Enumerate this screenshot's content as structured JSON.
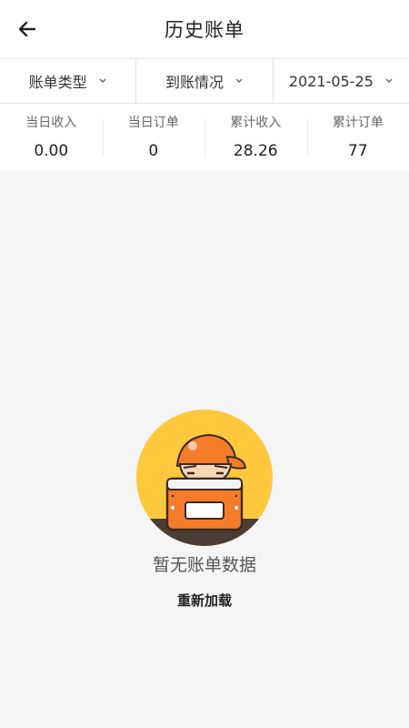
{
  "header": {
    "title": "历史账单",
    "back_icon": "arrow-left-icon"
  },
  "filters": [
    {
      "label": "账单类型",
      "icon": "chevron-down-icon"
    },
    {
      "label": "到账情况",
      "icon": "chevron-down-icon"
    },
    {
      "label": "2021-05-25",
      "icon": "chevron-down-icon"
    }
  ],
  "stats": [
    {
      "label": "当日收入",
      "value": "0.00"
    },
    {
      "label": "当日订单",
      "value": "0"
    },
    {
      "label": "累计收入",
      "value": "28.26"
    },
    {
      "label": "累计订单",
      "value": "77"
    }
  ],
  "empty_state": {
    "illustration": "empty-box-person-illustration",
    "message": "暂无账单数据",
    "reload_label": "重新加载"
  },
  "colors": {
    "accent_orange": "#F57C2A",
    "circle_yellow": "#FFC83D",
    "background": "#F5F5F5"
  }
}
